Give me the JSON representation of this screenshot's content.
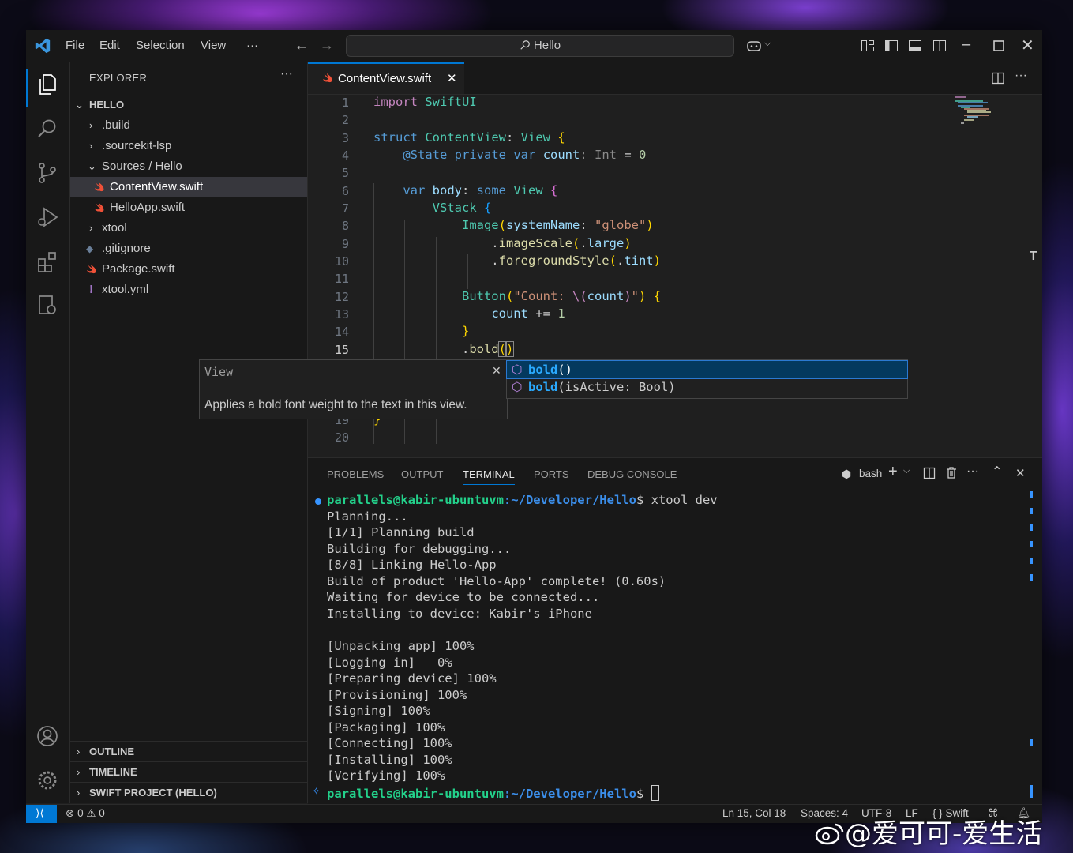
{
  "menu": [
    "File",
    "Edit",
    "Selection",
    "View",
    "···"
  ],
  "command_center": "Hello",
  "explorer": {
    "title": "EXPLORER",
    "more": "···",
    "root": "HELLO",
    "items": [
      {
        "label": ".build"
      },
      {
        "label": ".sourcekit-lsp"
      },
      {
        "label": "Sources / Hello"
      },
      {
        "label": "ContentView.swift"
      },
      {
        "label": "HelloApp.swift"
      },
      {
        "label": "xtool"
      },
      {
        "label": ".gitignore"
      },
      {
        "label": "Package.swift"
      },
      {
        "label": "xtool.yml"
      }
    ],
    "sections": [
      "OUTLINE",
      "TIMELINE",
      "SWIFT PROJECT (HELLO)"
    ]
  },
  "tab": {
    "label": "ContentView.swift"
  },
  "editor": {
    "line_numbers": [
      "1",
      "2",
      "3",
      "4",
      "5",
      "6",
      "7",
      "8",
      "9",
      "10",
      "11",
      "12",
      "13",
      "14",
      "15",
      "19",
      "20"
    ],
    "hover": {
      "title": "View",
      "text": "Applies a bold font weight to the text in this view."
    },
    "suggestions": [
      {
        "name": "bold",
        "sig": "()"
      },
      {
        "name": "bold",
        "sig": "(isActive: Bool)"
      }
    ]
  },
  "panel": {
    "tabs": [
      "PROBLEMS",
      "OUTPUT",
      "TERMINAL",
      "PORTS",
      "DEBUG CONSOLE"
    ],
    "shell": "bash",
    "prompt_user": "parallels@kabir-ubuntuvm",
    "prompt_path": ":~/Developer/Hello",
    "command": "$ xtool dev",
    "prompt_end": "$",
    "output": [
      "Planning...",
      "[1/1] Planning build",
      "Building for debugging...",
      "[8/8] Linking Hello-App",
      "Build of product 'Hello-App' complete! (0.60s)",
      "Waiting for device to be connected...",
      "Installing to device: Kabir's iPhone",
      "",
      "[Unpacking app] 100%",
      "[Logging in]   0%",
      "[Preparing device] 100%",
      "[Provisioning] 100%",
      "[Signing] 100%",
      "[Packaging] 100%",
      "[Connecting] 100%",
      "[Installing] 100%",
      "[Verifying] 100%"
    ]
  },
  "status": {
    "errors": "0",
    "warnings": "0",
    "position": "Ln 15, Col 18",
    "spaces": "Spaces: 4",
    "encoding": "UTF-8",
    "eol": "LF",
    "language": "{ } Swift"
  },
  "watermark": "@爱可可-爱生活"
}
